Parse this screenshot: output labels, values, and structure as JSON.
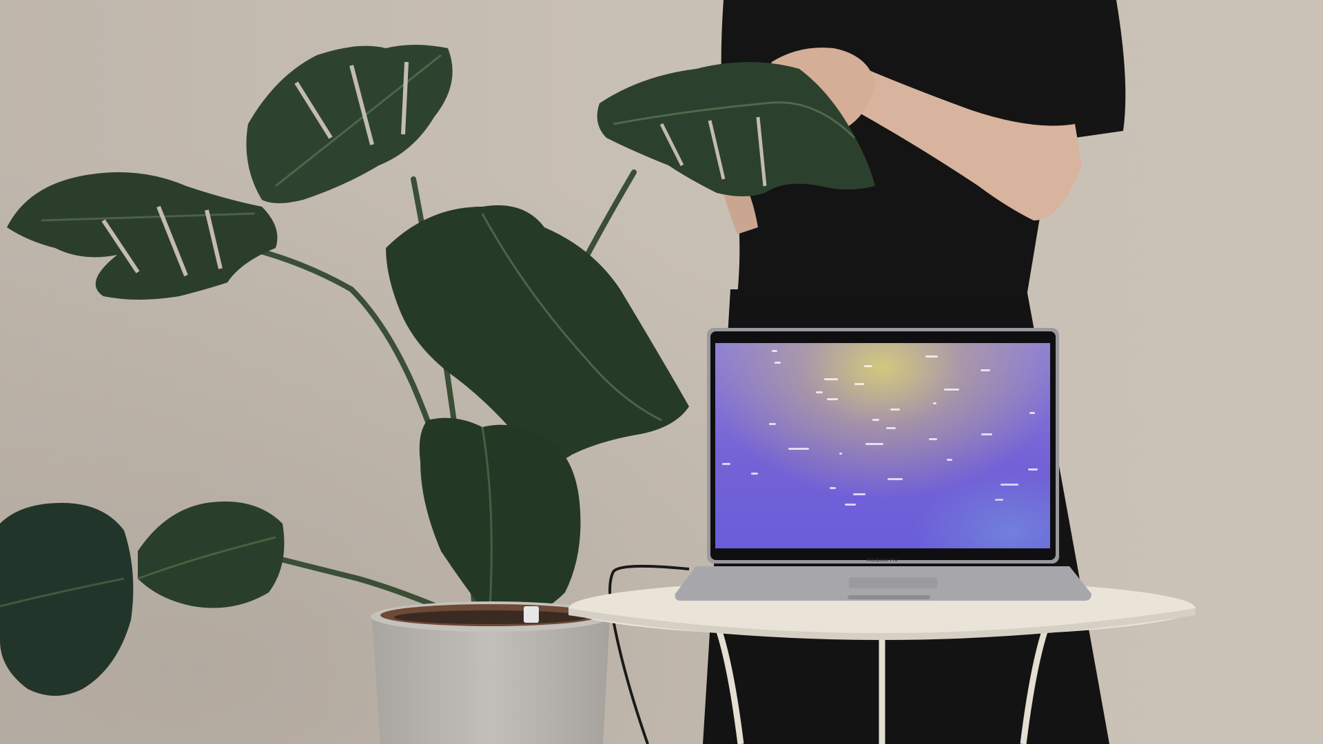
{
  "scene": {
    "subject": "photo",
    "laptop": {
      "brand_label": "MacBook Pro",
      "screen_words_legible": false,
      "screen_word_count": 31
    },
    "colors": {
      "wall": "#c4bbb1",
      "leaf": "#2a3f2c",
      "pot": "#b9b5b0",
      "table": "#e9e3d8",
      "clothing": "#141313",
      "skin": "#d8b49e",
      "screen_purple": "#7463d6",
      "screen_yellow": "#d6cd78"
    },
    "icons": [
      "plant-pot-icon",
      "laptop-icon",
      "table-icon",
      "cable-icon"
    ]
  }
}
